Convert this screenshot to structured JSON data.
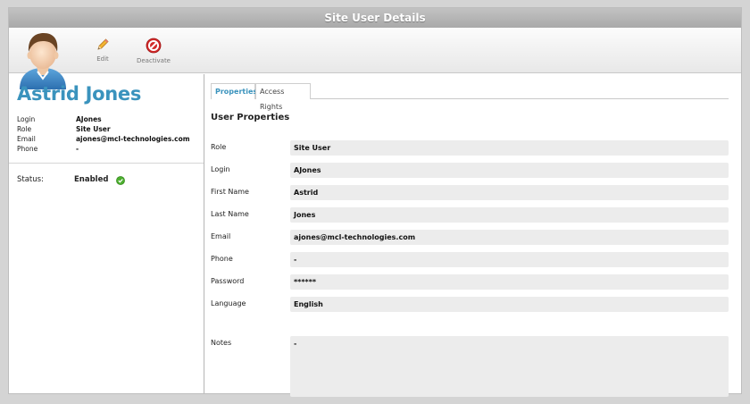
{
  "window": {
    "title": "Site User Details"
  },
  "toolbar": {
    "edit_label": "Edit",
    "deactivate_label": "Deactivate"
  },
  "user": {
    "name": "Astrid Jones",
    "summary": [
      {
        "label": "Login",
        "value": "AJones"
      },
      {
        "label": "Role",
        "value": "Site User"
      },
      {
        "label": "Email",
        "value": "ajones@mcl-technologies.com"
      },
      {
        "label": "Phone",
        "value": "-"
      }
    ],
    "status_label": "Status:",
    "status_value": "Enabled"
  },
  "tabs": [
    {
      "label": "Properties",
      "active": true
    },
    {
      "label": "Access Rights",
      "active": false
    }
  ],
  "properties": {
    "section_title": "User Properties",
    "fields": [
      {
        "label": "Role",
        "value": "Site User"
      },
      {
        "label": "Login",
        "value": "AJones"
      },
      {
        "label": "First Name",
        "value": "Astrid"
      },
      {
        "label": "Last Name",
        "value": "Jones"
      },
      {
        "label": "Email",
        "value": "ajones@mcl-technologies.com"
      },
      {
        "label": "Phone",
        "value": "-"
      },
      {
        "label": "Password",
        "value": "******"
      },
      {
        "label": "Language",
        "value": "English"
      },
      {
        "label": "Notes",
        "value": "-"
      }
    ]
  },
  "colors": {
    "accent": "#3a93bd",
    "status_ok": "#4cae2e",
    "deactivate": "#d22a2a"
  },
  "icons": {
    "edit": "pencil-icon",
    "deactivate": "no-entry-icon",
    "status": "check-circle-icon",
    "avatar": "user-avatar-icon"
  }
}
